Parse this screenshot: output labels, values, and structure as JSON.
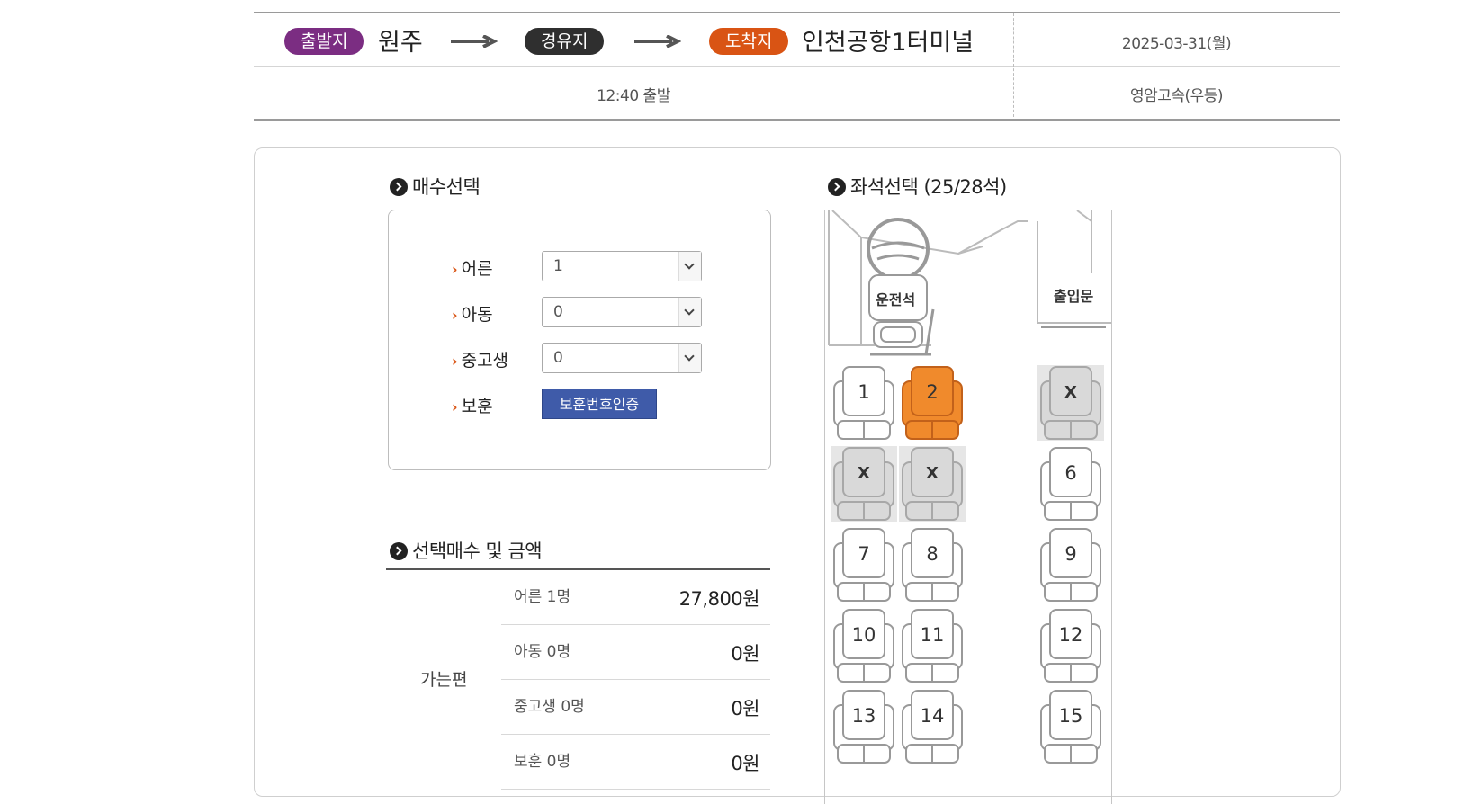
{
  "route": {
    "departure_badge": "출발지",
    "departure": "원주",
    "via_badge": "경유지",
    "arrival_badge": "도착지",
    "arrival": "인천공항1터미널",
    "date": "2025-03-31(월)",
    "departure_time": "12:40 출발",
    "company": "영암고속(우등)"
  },
  "count_section": {
    "title": "매수선택",
    "rows": [
      {
        "label": "어른",
        "value": "1"
      },
      {
        "label": "아동",
        "value": "0"
      },
      {
        "label": "중고생",
        "value": "0"
      },
      {
        "label": "보훈",
        "button": "보훈번호인증"
      }
    ]
  },
  "price_section": {
    "title": "선택매수 및 금액",
    "category": "가는편",
    "rows": [
      {
        "label": "어른 1명",
        "value": "27,800원"
      },
      {
        "label": "아동 0명",
        "value": "0원"
      },
      {
        "label": "중고생 0명",
        "value": "0원"
      },
      {
        "label": "보훈 0명",
        "value": "0원"
      }
    ]
  },
  "seat_section": {
    "title": "좌석선택 (25/28석)",
    "driver_label": "운전석",
    "door_label": "출입문",
    "seats": [
      {
        "label": "1",
        "state": "available"
      },
      {
        "label": "2",
        "state": "selected"
      },
      {
        "label": "X",
        "state": "taken"
      },
      {
        "label": "X",
        "state": "taken"
      },
      {
        "label": "X",
        "state": "taken"
      },
      {
        "label": "6",
        "state": "available"
      },
      {
        "label": "7",
        "state": "available"
      },
      {
        "label": "8",
        "state": "available"
      },
      {
        "label": "9",
        "state": "available"
      },
      {
        "label": "10",
        "state": "available"
      },
      {
        "label": "11",
        "state": "available"
      },
      {
        "label": "12",
        "state": "available"
      },
      {
        "label": "13",
        "state": "available"
      },
      {
        "label": "14",
        "state": "available"
      },
      {
        "label": "15",
        "state": "available"
      }
    ]
  },
  "colors": {
    "departure": "#7b2d82",
    "via": "#2f2f2f",
    "arrival": "#d95414",
    "selected_seat": "#f08a2c",
    "taken_seat": "#d9d9d9",
    "verify_button": "#3f5ba9"
  },
  "icons": [
    "arrow-right-icon",
    "section-bullet-icon",
    "steering-wheel-icon",
    "seat-icon",
    "chevron-down-icon"
  ]
}
